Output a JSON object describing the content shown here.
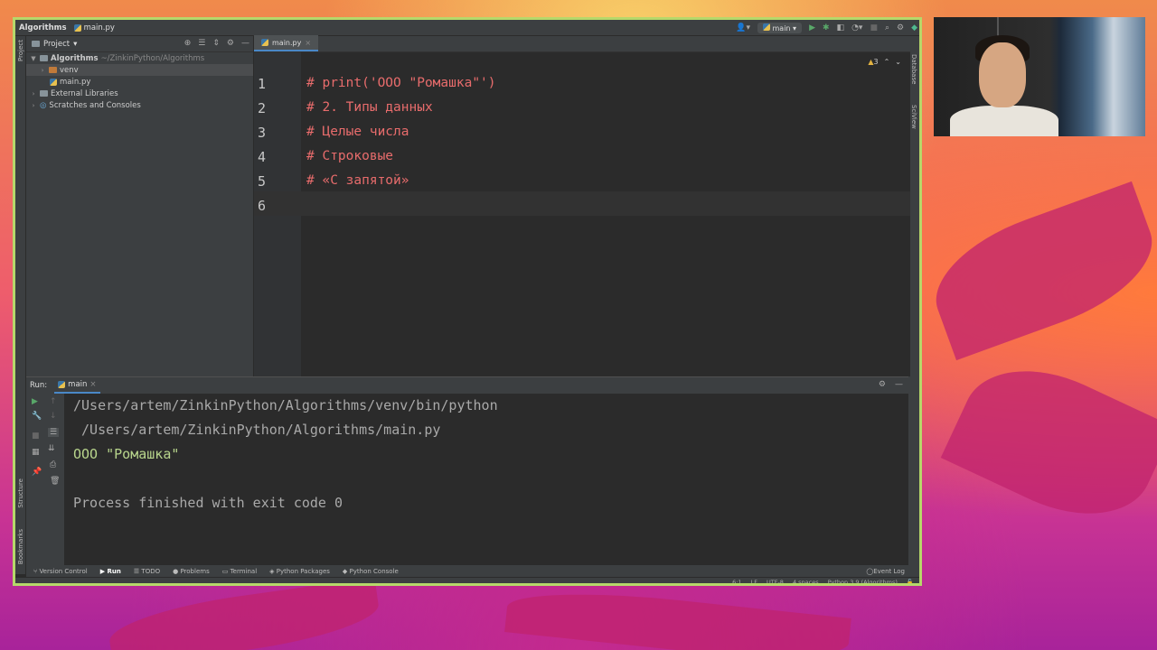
{
  "titlebar": {
    "project_name": "Algorithms",
    "file_name": "main.py",
    "run_config": "main"
  },
  "left_strip": {
    "project_label": "Project",
    "structure_label": "Structure",
    "bookmarks_label": "Bookmarks"
  },
  "right_strip": {
    "database_label": "Database",
    "sciview_label": "SciView"
  },
  "project_pane": {
    "title": "Project",
    "root_name": "Algorithms",
    "root_path": "~/ZinkinPython/Algorithms",
    "items": [
      {
        "label": "venv"
      },
      {
        "label": "main.py"
      },
      {
        "label": "External Libraries"
      },
      {
        "label": "Scratches and Consoles"
      }
    ]
  },
  "editor": {
    "tab_label": "main.py",
    "warnings_count": "3",
    "line_numbers": [
      "1",
      "2",
      "3",
      "4",
      "5",
      "6"
    ],
    "lines": [
      "# print('ООО \"Ромашка\"')",
      "# 2. Типы данных",
      "# Целые числа",
      "# Строковые",
      "# «С запятой»",
      ""
    ]
  },
  "run_pane": {
    "label": "Run:",
    "tab_label": "main",
    "output": [
      "/Users/artem/ZinkinPython/Algorithms/venv/bin/python",
      " /Users/artem/ZinkinPython/Algorithms/main.py",
      "ООО \"Ромашка\"",
      "",
      "Process finished with exit code 0"
    ]
  },
  "bottom_tools": {
    "version_control": "Version Control",
    "run": "Run",
    "todo": "TODO",
    "problems": "Problems",
    "terminal": "Terminal",
    "python_packages": "Python Packages",
    "python_console": "Python Console",
    "event_log": "Event Log"
  },
  "status_bar": {
    "position": "6:1",
    "line_sep": "LF",
    "encoding": "UTF-8",
    "indent": "4 spaces",
    "interpreter": "Python 3.9 (Algorithms)"
  },
  "colors": {
    "accent_border": "#b6d86a",
    "comment_red": "#e86c6c",
    "output_green": "#b8d58c"
  }
}
